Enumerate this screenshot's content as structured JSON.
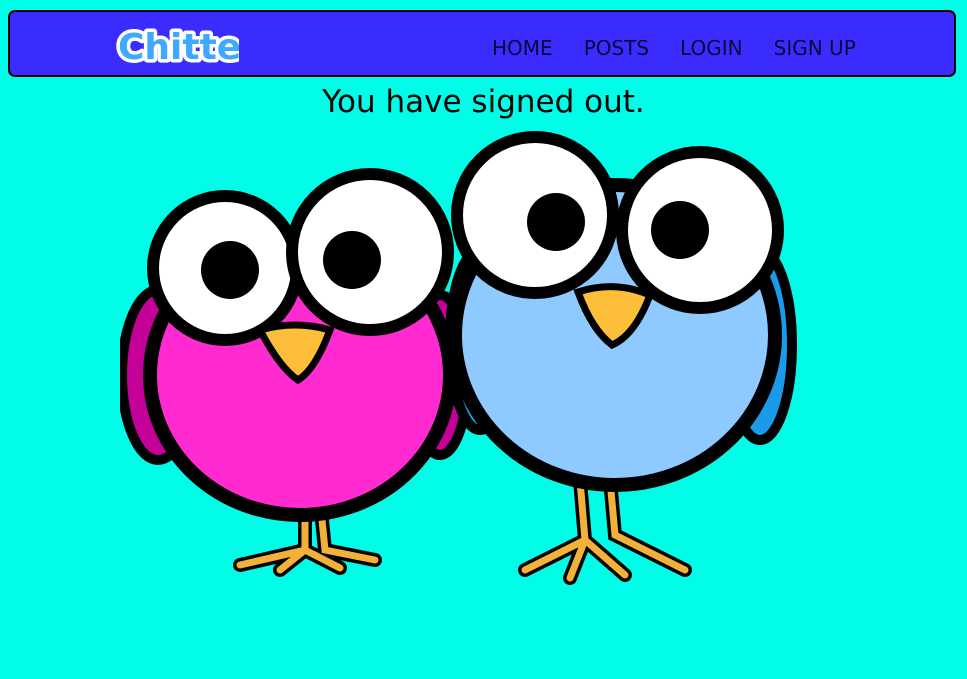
{
  "navbar": {
    "logo_text": "Chitter",
    "links": [
      {
        "label": "HOME"
      },
      {
        "label": "POSTS"
      },
      {
        "label": "LOGIN"
      },
      {
        "label": "SIGN UP"
      }
    ]
  },
  "main": {
    "message": "You have signed out."
  },
  "colors": {
    "background": "#00fde8",
    "navbar": "#3a2cff",
    "pink_bird": "#ff2ad0",
    "blue_bird": "#8ecaff",
    "beak": "#fdbf3a"
  },
  "image": {
    "subject": "two cartoon birds icon"
  }
}
